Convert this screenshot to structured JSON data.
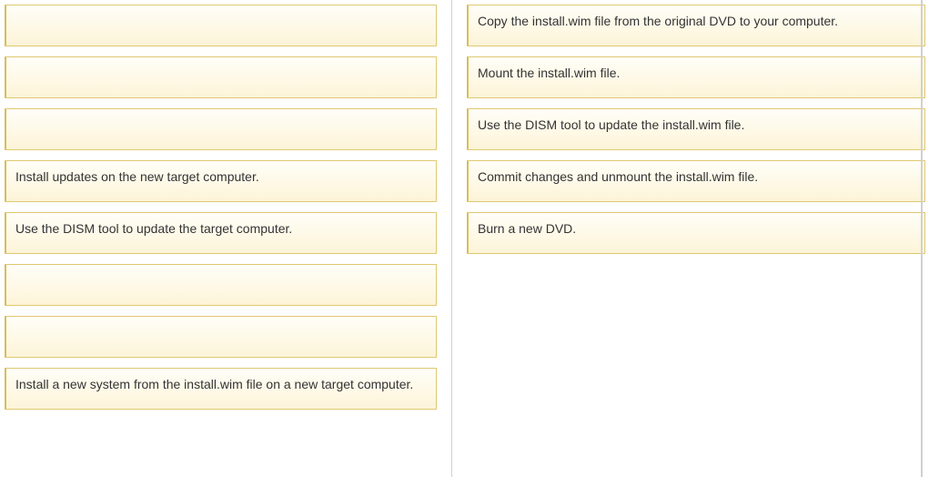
{
  "left": {
    "items": [
      {
        "label": ""
      },
      {
        "label": ""
      },
      {
        "label": ""
      },
      {
        "label": "Install updates on the new target computer."
      },
      {
        "label": "Use the DISM tool to update the target computer."
      },
      {
        "label": ""
      },
      {
        "label": ""
      },
      {
        "label": "Install a new system from the install.wim file on a new target computer."
      }
    ]
  },
  "right": {
    "items": [
      {
        "label": "Copy the install.wim file from the original DVD to your computer."
      },
      {
        "label": "Mount the install.wim file."
      },
      {
        "label": "Use the DISM tool to update the install.wim file."
      },
      {
        "label": "Commit changes and unmount the install.wim file."
      },
      {
        "label": "Burn a new DVD."
      }
    ]
  }
}
